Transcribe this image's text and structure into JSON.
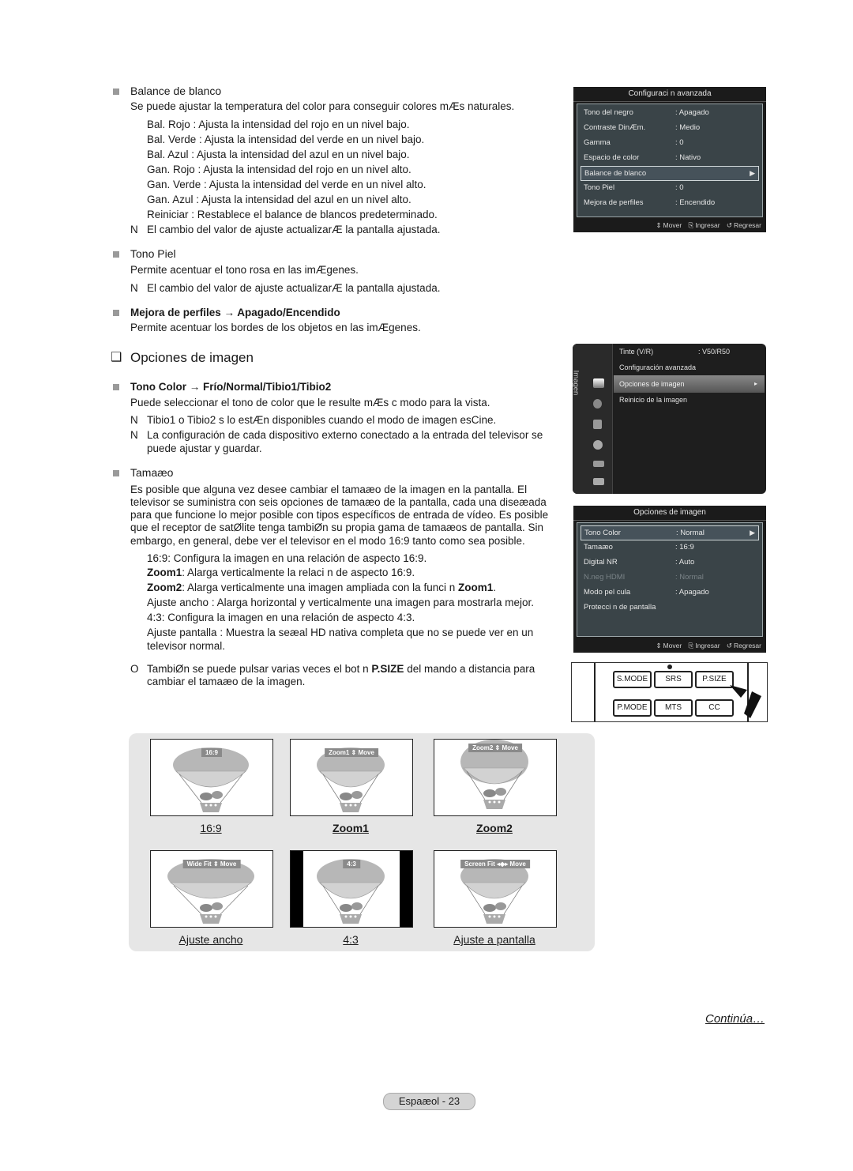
{
  "balance": {
    "title": "Balance de blanco",
    "desc": "Se puede ajustar la temperatura del color para conseguir colores mÆs naturales.",
    "items": [
      "Bal. Rojo : Ajusta la intensidad del rojo en un nivel bajo.",
      "Bal. Verde : Ajusta la intensidad del verde en un nivel bajo.",
      "Bal. Azul : Ajusta la intensidad del azul en un nivel bajo.",
      "Gan. Rojo : Ajusta la intensidad del rojo en un nivel alto.",
      "Gan. Verde : Ajusta la intensidad del verde en un nivel alto.",
      "Gan. Azul : Ajusta la intensidad del azul en un nivel alto.",
      "Reiniciar : Restablece el balance de blancos predeterminado."
    ],
    "note_marker": "N",
    "note": "El cambio del valor de ajuste actualizarÆ la pantalla ajustada."
  },
  "tono_piel": {
    "title": "Tono Piel",
    "desc": "Permite acentuar el tono rosa en las imÆgenes.",
    "note_marker": "N",
    "note": "El cambio del valor de ajuste actualizarÆ la pantalla ajustada."
  },
  "mejora": {
    "title": "Mejora de perfiles → Apagado/Encendido",
    "desc": "Permite acentuar los bordes de los objetos en las imÆgenes."
  },
  "section": {
    "checkbox_glyph": "❑",
    "title": "Opciones de imagen"
  },
  "tono_color": {
    "title": "Tono Color → Frío/Normal/Tibio1/Tibio2",
    "desc": "Puede seleccionar el tono de color que le resulte mÆs c modo para la vista.",
    "notes": [
      {
        "marker": "N",
        "text": "Tibio1  o Tibio2  s lo estÆn disponibles cuando el modo de imagen esCine."
      },
      {
        "marker": "N",
        "text": "La configuración de cada dispositivo externo conectado a la entrada del televisor se"
      },
      {
        "marker": "",
        "text": "puede ajustar y guardar."
      }
    ]
  },
  "tamano": {
    "title": "Tamaæo",
    "desc_lines": [
      "Es posible que alguna vez desee cambiar el tamaæo de la imagen en la pantalla. El",
      "televisor se suministra con seis opciones de tamaæo de la pantalla, cada una diseæada",
      "para que funcione lo mejor posible con tipos específicos de entrada de vídeo. Es posible",
      "que el receptor de satØlite tenga tambiØn su propia gama de tamaæos de pantalla. Sin",
      "embargo, en general, debe ver el televisor en el modo 16:9 tanto como sea posible."
    ],
    "options": [
      {
        "key": "16:9",
        "text": ": Configura la imagen en una relación de aspecto 16:9."
      },
      {
        "key": "Zoom1",
        "text": ": Alarga verticalmente la relaci n de aspecto 16:9."
      },
      {
        "key": "Zoom2",
        "text": ":  Alarga verticalmente una imagen ampliada con la funci n  ",
        "suffix": "Zoom1",
        "end": "."
      },
      {
        "key": "Ajuste ancho ",
        "text": " : Alarga horizontal y verticalmente una imagen para mostrarla mejor."
      },
      {
        "key": "4:3",
        "text": ": Configura la imagen en una relación de aspecto 4:3."
      },
      {
        "key": "Ajuste pantalla ",
        "text": " : Muestra la seæal HD nativa completa que no se puede ver en un"
      },
      {
        "key": "",
        "text": "televisor normal."
      }
    ],
    "tip_marker": "O",
    "tip_pre": "TambiØn se puede pulsar varias veces el bot n ",
    "tip_bold": "P.SIZE",
    "tip_post": " del mando a distancia para",
    "tip_line2": "cambiar el tamaæo de la imagen."
  },
  "osd_advanced": {
    "title": "Configuraci n avanzada",
    "rows": [
      {
        "label": "Tono del negro",
        "value": ": Apagado"
      },
      {
        "label": "Contraste DinÆm.",
        "value": ": Medio"
      },
      {
        "label": "Gamma",
        "value": ": 0"
      },
      {
        "label": "Espacio de color",
        "value": ": Nativo"
      },
      {
        "label": "Balance de blanco",
        "value": "",
        "selected": true,
        "arrow": "▶"
      },
      {
        "label": "Tono Piel",
        "value": ": 0"
      },
      {
        "label": "Mejora de perfiles",
        "value": ": Encendido"
      }
    ],
    "footer": {
      "move": "Mover",
      "enter": "Ingresar",
      "back": "Regresar"
    }
  },
  "main_menu": {
    "category": "Imagen",
    "items": [
      {
        "label": "Tinte (V/R)",
        "value": ": V50/R50"
      },
      {
        "label": "Configuración avanzada",
        "value": ""
      },
      {
        "label": "Opciones de imagen",
        "value": "",
        "selected": true,
        "arrow": "▸"
      },
      {
        "label": "Reinicio de la imagen",
        "value": ""
      }
    ],
    "icons": [
      "picture-icon",
      "sound-icon",
      "channel-icon",
      "setup-icon",
      "input-icon",
      "application-icon"
    ]
  },
  "osd_picture_options": {
    "title": "Opciones de imagen",
    "rows": [
      {
        "label": "Tono Color",
        "value": ": Normal",
        "selected": true,
        "arrow": "▶"
      },
      {
        "label": "Tamaæo",
        "value": ": 16:9"
      },
      {
        "label": "Digital NR",
        "value": ": Auto"
      },
      {
        "label": "N.neg HDMI",
        "value": ": Normal",
        "disabled": true
      },
      {
        "label": "Modo pel cula",
        "value": ": Apagado"
      },
      {
        "label": "Protecci n de pantalla",
        "value": ""
      }
    ],
    "footer": {
      "move": "Mover",
      "enter": "Ingresar",
      "back": "Regresar"
    }
  },
  "remote": {
    "buttons_row1": [
      "S.MODE",
      "SRS",
      "P.SIZE"
    ],
    "buttons_row2": [
      "P.MODE",
      "MTS",
      "CC"
    ]
  },
  "size_examples": [
    {
      "osd": "16:9",
      "caption": "16:9",
      "bold": false
    },
    {
      "osd": "Zoom1 ⇕ Move",
      "caption": "Zoom1",
      "bold": true
    },
    {
      "osd": "Zoom2 ⇕ Move",
      "caption": "Zoom2",
      "bold": true
    },
    {
      "osd": "Wide Fit ⇕ Move",
      "caption": "Ajuste ancho ",
      "bold": false
    },
    {
      "osd": "4:3",
      "caption": "4:3",
      "bold": false
    },
    {
      "osd": "Screen Fit ◂◆▸ Move",
      "caption": "Ajuste a pantalla ",
      "bold": false
    }
  ],
  "continua": "Continúa…",
  "page_label": "Espaæol - 23"
}
